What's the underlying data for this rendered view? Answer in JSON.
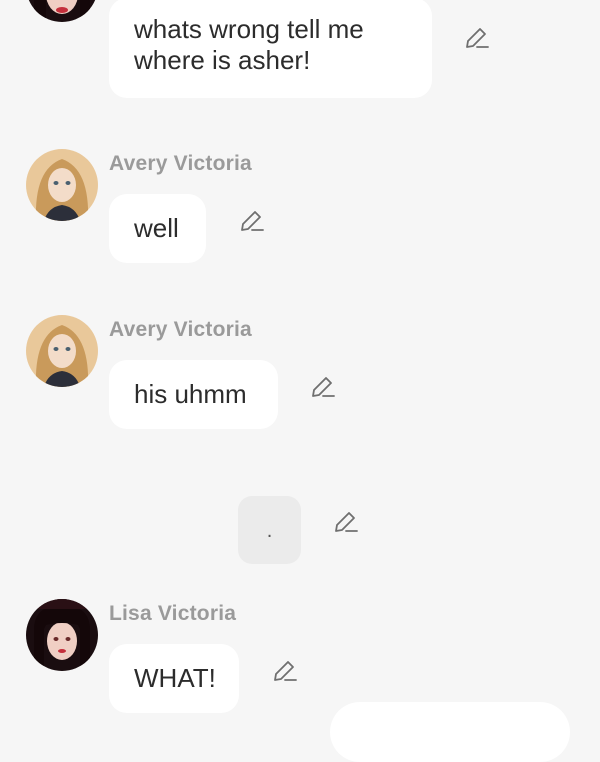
{
  "messages": [
    {
      "text": "whats wrong tell me where is asher!"
    },
    {
      "sender": "Avery Victoria",
      "text": "well"
    },
    {
      "sender": "Avery Victoria",
      "text": "his uhmm"
    },
    {
      "text": "."
    },
    {
      "sender": "Lisa Victoria",
      "text": "WHAT!"
    }
  ],
  "icons": {
    "edit": "pencil-edit-icon"
  },
  "colors": {
    "background": "#f6f6f6",
    "bubble": "#ffffff",
    "system_bubble": "#ebebeb",
    "sender_name": "#9a9a9a",
    "icon": "#6f6f6f"
  }
}
